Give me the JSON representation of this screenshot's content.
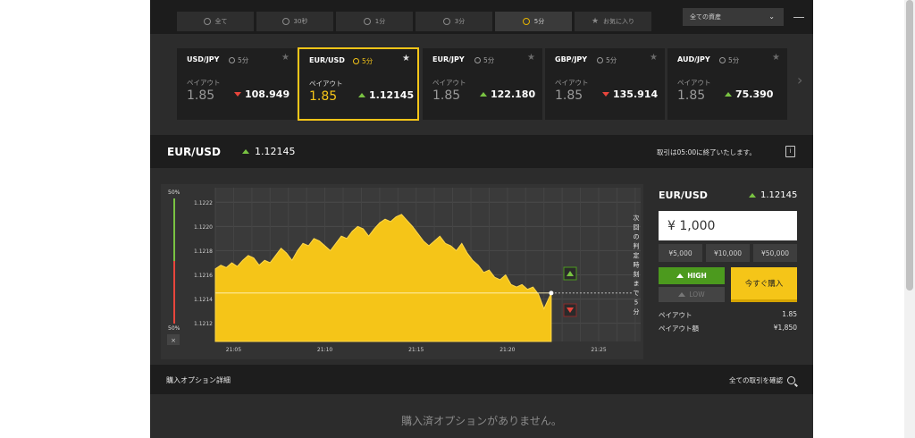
{
  "filters": {
    "tabs": [
      {
        "label": "全て",
        "icon": "clock-icon"
      },
      {
        "label": "30秒",
        "icon": "clock-icon"
      },
      {
        "label": "1分",
        "icon": "clock-icon"
      },
      {
        "label": "3分",
        "icon": "clock-icon"
      },
      {
        "label": "5分",
        "icon": "clock-icon",
        "active": true
      },
      {
        "label": "お気に入り",
        "icon": "star-icon"
      }
    ],
    "asset_select": "全ての資産"
  },
  "cards": [
    {
      "symbol": "USD/JPY",
      "time": "5分",
      "payout_label": "ペイアウト",
      "payout": "1.85",
      "price": "108.949",
      "dir": "down"
    },
    {
      "symbol": "EUR/USD",
      "time": "5分",
      "payout_label": "ペイアウト",
      "payout": "1.85",
      "price": "1.12145",
      "dir": "up",
      "active": true
    },
    {
      "symbol": "EUR/JPY",
      "time": "5分",
      "payout_label": "ペイアウト",
      "payout": "1.85",
      "price": "122.180",
      "dir": "up"
    },
    {
      "symbol": "GBP/JPY",
      "time": "5分",
      "payout_label": "ペイアウト",
      "payout": "1.85",
      "price": "135.914",
      "dir": "down"
    },
    {
      "symbol": "AUD/JPY",
      "time": "5分",
      "payout_label": "ペイアウト",
      "payout": "1.85",
      "price": "75.390",
      "dir": "up"
    }
  ],
  "selected": {
    "symbol": "EUR/USD",
    "rate": "1.12145",
    "closing_text": "取引は05:00に終了いたします。"
  },
  "sentiment": {
    "top": "50%",
    "bottom": "50%",
    "up_color": "#79c342",
    "down_color": "#e8453c"
  },
  "chart_data": {
    "type": "area",
    "yticks": [
      "1.1222",
      "1.1220",
      "1.1218",
      "1.1216",
      "1.1214",
      "1.1212"
    ],
    "ytick_values": [
      1.1222,
      1.122,
      1.1218,
      1.1216,
      1.1214,
      1.1212
    ],
    "ylim": [
      1.12105,
      1.12232
    ],
    "xticks": [
      "21:05",
      "21:10",
      "21:15",
      "21:20",
      "21:25"
    ],
    "xtick_minutes": [
      5,
      10,
      15,
      20,
      25
    ],
    "xlim": [
      4,
      27.3
    ],
    "current_value": 1.12145,
    "current_minute": 22.4,
    "countdown_label": "次回の判定時刻まで5分",
    "x": [
      4.0,
      4.3,
      4.6,
      4.9,
      5.2,
      5.5,
      5.8,
      6.1,
      6.4,
      6.7,
      7.0,
      7.3,
      7.6,
      7.9,
      8.2,
      8.5,
      8.8,
      9.1,
      9.4,
      9.7,
      10.0,
      10.3,
      10.6,
      10.9,
      11.2,
      11.5,
      11.8,
      12.1,
      12.4,
      12.7,
      13.0,
      13.3,
      13.6,
      13.9,
      14.2,
      14.5,
      14.8,
      15.1,
      15.4,
      15.7,
      16.0,
      16.3,
      16.6,
      16.9,
      17.2,
      17.5,
      17.8,
      18.1,
      18.4,
      18.7,
      19.0,
      19.3,
      19.6,
      19.9,
      20.2,
      20.5,
      20.8,
      21.1,
      21.4,
      21.7,
      22.0,
      22.4
    ],
    "y": [
      1.12165,
      1.12168,
      1.12166,
      1.1217,
      1.12167,
      1.12172,
      1.12176,
      1.12174,
      1.12168,
      1.12172,
      1.1217,
      1.12176,
      1.12182,
      1.12178,
      1.12172,
      1.1218,
      1.12186,
      1.12184,
      1.1219,
      1.12188,
      1.12184,
      1.1218,
      1.12186,
      1.12192,
      1.1219,
      1.12196,
      1.122,
      1.12198,
      1.12192,
      1.12198,
      1.12203,
      1.12206,
      1.12204,
      1.12208,
      1.1221,
      1.12205,
      1.122,
      1.12194,
      1.12188,
      1.12184,
      1.12188,
      1.12192,
      1.12186,
      1.12184,
      1.1218,
      1.12186,
      1.12178,
      1.12172,
      1.12168,
      1.12162,
      1.12164,
      1.12158,
      1.12156,
      1.1216,
      1.12152,
      1.1215,
      1.12152,
      1.12148,
      1.1215,
      1.12144,
      1.12132,
      1.12145
    ]
  },
  "trade": {
    "symbol": "EUR/USD",
    "rate": "1.12145",
    "amount": "¥ 1,000",
    "quick_amounts": [
      "¥5,000",
      "¥10,000",
      "¥50,000"
    ],
    "high_label": "HIGH",
    "low_label": "LOW",
    "buy_label": "今すぐ購入",
    "payout_label": "ペイアウト",
    "payout_value": "1.85",
    "payout_amount_label": "ペイアウト額",
    "payout_amount_value": "¥1,850",
    "colors": {
      "accent": "#f5c518",
      "high": "#4c9a1e"
    }
  },
  "options": {
    "title": "購入オプション詳細",
    "view_all": "全ての取引を確認",
    "empty": "購入済オプションがありません。"
  }
}
